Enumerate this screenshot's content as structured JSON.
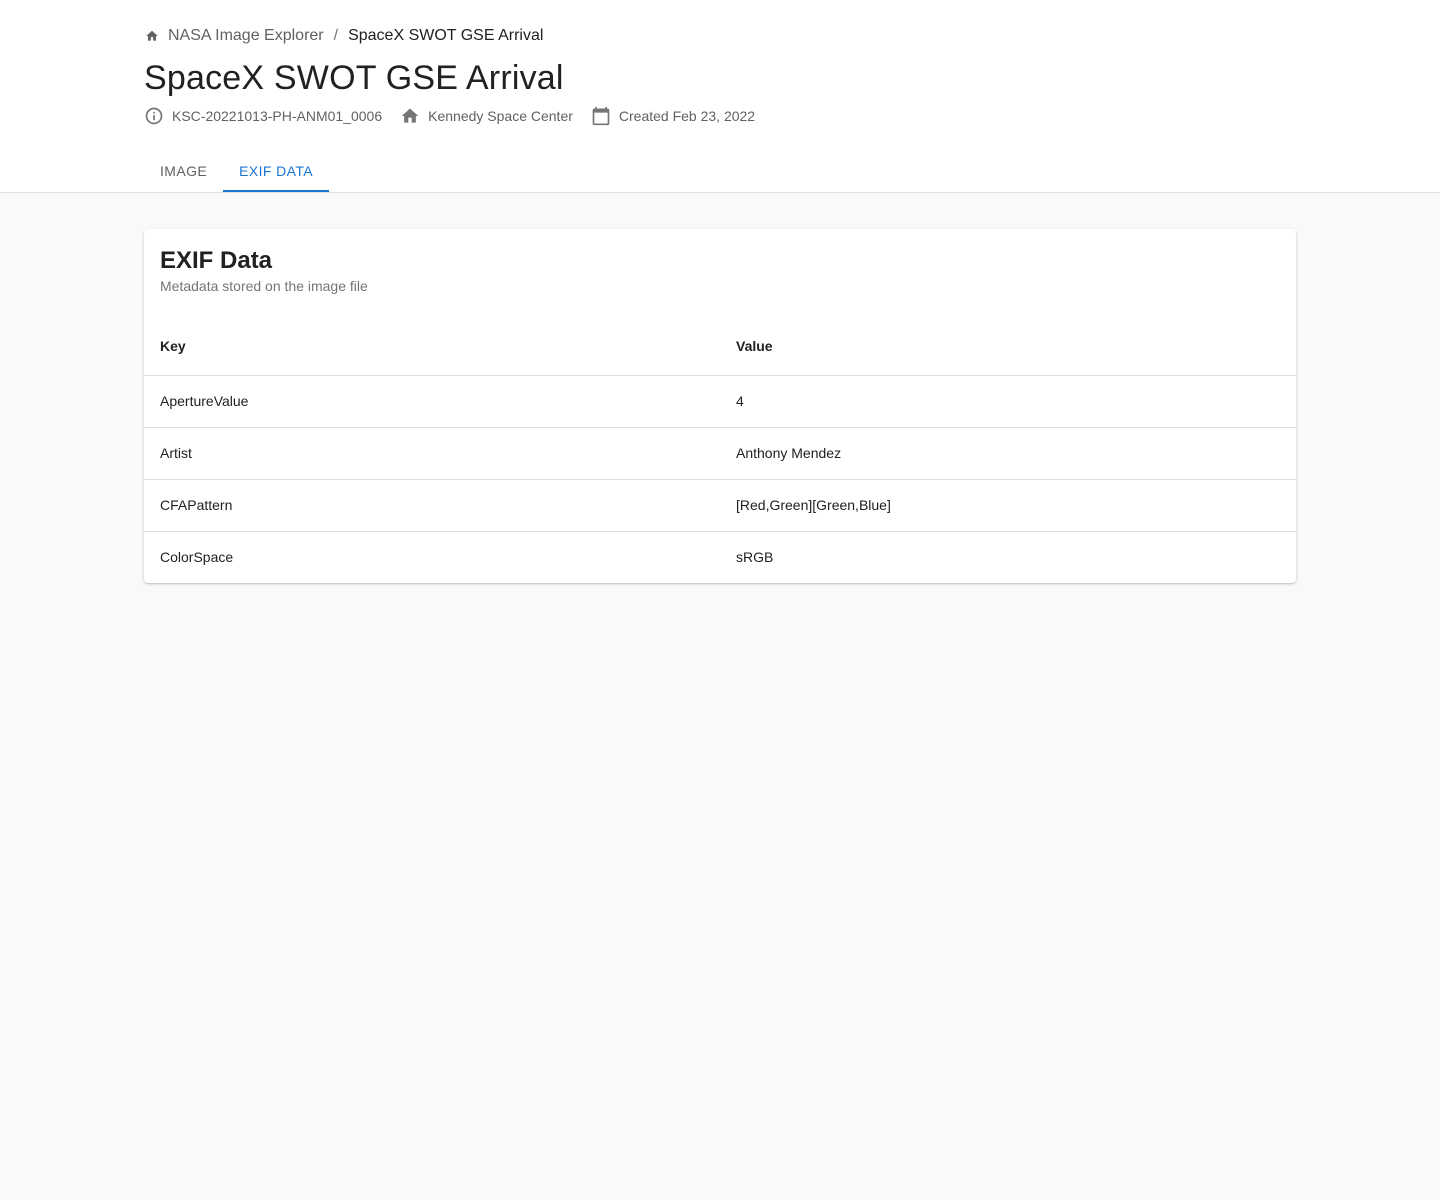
{
  "breadcrumb": {
    "home_icon": "home-icon",
    "root_label": "NASA Image Explorer",
    "separator": "/",
    "current_label": "SpaceX SWOT GSE Arrival"
  },
  "page": {
    "title": "SpaceX SWOT GSE Arrival"
  },
  "meta": {
    "id": {
      "icon": "info-icon",
      "text": "KSC-20221013-PH-ANM01_0006"
    },
    "center": {
      "icon": "home-icon",
      "text": "Kennedy Space Center"
    },
    "created": {
      "icon": "calendar-icon",
      "text": "Created Feb 23, 2022"
    }
  },
  "tabs": [
    {
      "label": "IMAGE",
      "active": false
    },
    {
      "label": "EXIF DATA",
      "active": true
    }
  ],
  "exif_card": {
    "title": "EXIF Data",
    "subtitle": "Metadata stored on the image file",
    "columns": {
      "key": "Key",
      "value": "Value"
    },
    "rows": [
      {
        "key": "ApertureValue",
        "value": "4"
      },
      {
        "key": "Artist",
        "value": "Anthony Mendez"
      },
      {
        "key": "CFAPattern",
        "value": "[Red,Green][Green,Blue]"
      },
      {
        "key": "ColorSpace",
        "value": "sRGB"
      }
    ]
  },
  "colors": {
    "accent": "#1976d2",
    "background": "#f8f9fb",
    "text_primary": "#212121",
    "text_secondary": "#616161"
  }
}
